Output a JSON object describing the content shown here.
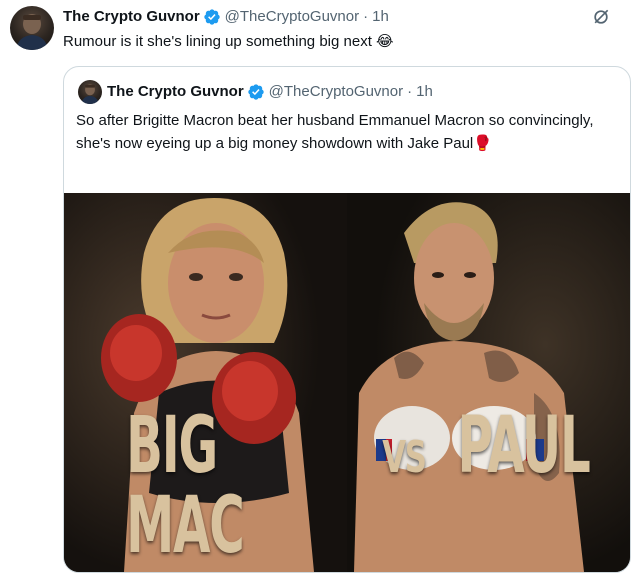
{
  "tweet": {
    "author_name": "The Crypto Guvnor",
    "handle": "@TheCryptoGuvnor",
    "time": "1h",
    "text": "Rumour is it she's lining up something big next 😂",
    "more_icon": "grok-icon"
  },
  "quoted_tweet": {
    "author_name": "The Crypto Guvnor",
    "handle": "@TheCryptoGuvnor",
    "time": "1h",
    "text": "So after Brigitte Macron beat her husband Emmanuel Macron so convincingly, she's now eyeing up a big money showdown with Jake Paul🥊",
    "media": {
      "headline_left": "BIG MAC",
      "headline_vs": "VS",
      "headline_right": "PAUL"
    }
  },
  "colors": {
    "verified": "#1d9bf0",
    "muted_text": "#536471",
    "border": "#cfd9de",
    "headline": "#d8c29e"
  }
}
